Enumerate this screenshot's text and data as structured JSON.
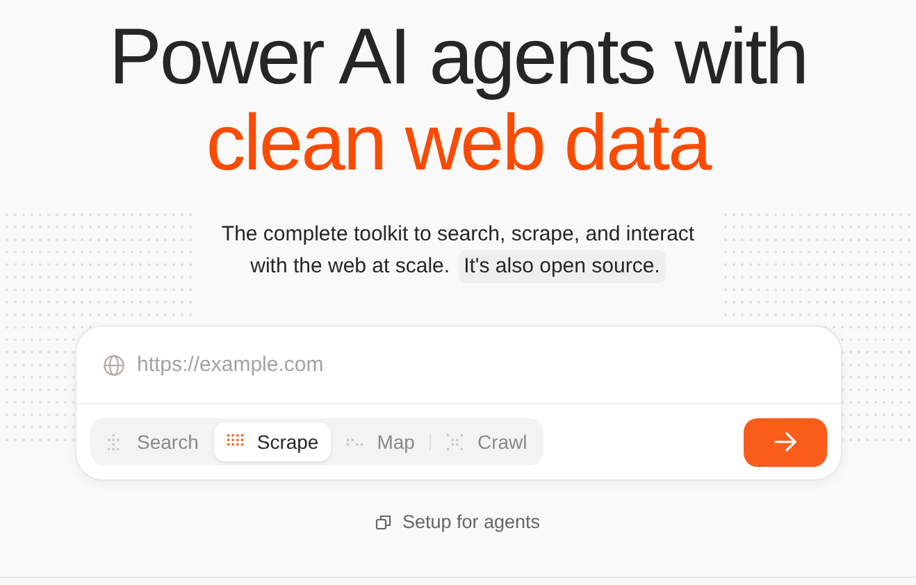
{
  "headline": {
    "line_1": "Power AI agents with",
    "line_2": "clean web data"
  },
  "subtitle": {
    "line_1": "The complete toolkit to search, scrape, and interact",
    "line_2": "with the web at scale.",
    "badge": "It's also open source."
  },
  "url_field": {
    "placeholder": "https://example.com"
  },
  "modes": [
    {
      "label": "Search",
      "selected": false
    },
    {
      "label": "Scrape",
      "selected": true
    },
    {
      "label": "Map",
      "selected": false
    },
    {
      "label": "Crawl",
      "selected": false
    }
  ],
  "setup_link": {
    "label": "Setup for agents"
  }
}
